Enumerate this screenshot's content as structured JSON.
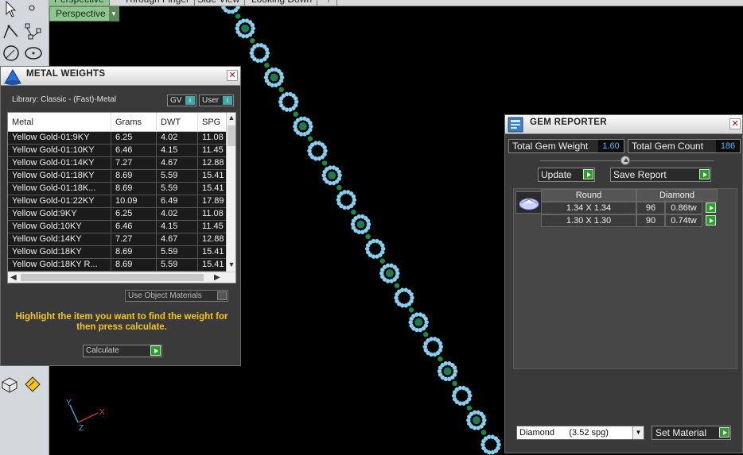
{
  "viewport": {
    "top_tabs": [
      "Perspective",
      "Through Finger",
      "Side View",
      "Looking Down",
      "?"
    ],
    "label": "Perspective",
    "bracelet_colors": {
      "halo": "#8fd0ee",
      "center": "#1f7a52",
      "link": "#1a8a4a"
    },
    "axis": {
      "x": "X",
      "y": "Y",
      "z": "Z"
    }
  },
  "metal_weights": {
    "title": "METAL WEIGHTS",
    "library": "Library: Classic - (Fast)-Metal",
    "gv_label": "GV",
    "user_label": "User",
    "columns": [
      "Metal",
      "Grams",
      "DWT",
      "SPG"
    ],
    "rows": [
      [
        "Yellow Gold-01:9KY",
        "6.25",
        "4.02",
        "11.08"
      ],
      [
        "Yellow Gold-01:10KY",
        "6.46",
        "4.15",
        "11.45"
      ],
      [
        "Yellow Gold-01:14KY",
        "7.27",
        "4.67",
        "12.88"
      ],
      [
        "Yellow Gold-01:18KY",
        "8.69",
        "5.59",
        "15.41"
      ],
      [
        "Yellow Gold-01:18K...",
        "8.69",
        "5.59",
        "15.41"
      ],
      [
        "Yellow Gold-01:22KY",
        "10.09",
        "6.49",
        "17.89"
      ],
      [
        "Yellow Gold:9KY",
        "6.25",
        "4.02",
        "11.08"
      ],
      [
        "Yellow Gold:10KY",
        "6.46",
        "4.15",
        "11.45"
      ],
      [
        "Yellow Gold:14KY",
        "7.27",
        "4.67",
        "12.88"
      ],
      [
        "Yellow Gold:18KY",
        "8.69",
        "5.59",
        "15.41"
      ],
      [
        "Yellow Gold:18KY R...",
        "8.69",
        "5.59",
        "15.41"
      ]
    ],
    "use_object_materials": "Use Object Materials",
    "hint": "Highlight the item you want to find the weight for then press calculate.",
    "calculate": "Calculate"
  },
  "gem_reporter": {
    "title": "GEM REPORTER",
    "total_weight_label": "Total Gem Weight",
    "total_weight": "1.60",
    "total_count_label": "Total Gem Count",
    "total_count": "186",
    "update": "Update",
    "save_report": "Save Report",
    "headers": {
      "shape": "Round",
      "material": "Diamond"
    },
    "gems": [
      {
        "size": "1.34 X 1.34",
        "count": "96",
        "weight": "0.86tw"
      },
      {
        "size": "1.30 X 1.30",
        "count": "90",
        "weight": "0.74tw"
      }
    ],
    "material_select": "Diamond      (3.52 spg)",
    "set_material": "Set Material"
  }
}
